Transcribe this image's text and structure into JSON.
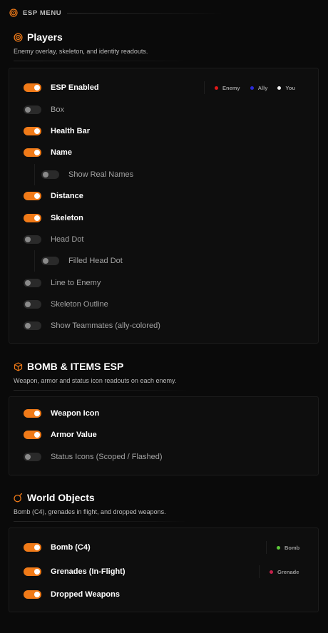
{
  "menu": {
    "title": "ESP MENU",
    "icon": "target-icon"
  },
  "players": {
    "title": "Players",
    "description": "Enemy overlay, skeleton, and identity readouts.",
    "icon": "target-icon",
    "legend": [
      {
        "label": "Enemy",
        "color": "#e01818"
      },
      {
        "label": "Ally",
        "color": "#2a2ad8"
      },
      {
        "label": "You",
        "color": "#f2f2f2"
      }
    ],
    "items": [
      {
        "label": "ESP Enabled",
        "on": true
      },
      {
        "label": "Box",
        "on": false
      },
      {
        "label": "Health Bar",
        "on": true
      },
      {
        "label": "Name",
        "on": true
      },
      {
        "label": "Show Real Names",
        "on": false
      },
      {
        "label": "Distance",
        "on": true
      },
      {
        "label": "Skeleton",
        "on": true
      },
      {
        "label": "Head Dot",
        "on": false
      },
      {
        "label": "Filled Head Dot",
        "on": false
      },
      {
        "label": "Line to Enemy",
        "on": false
      },
      {
        "label": "Skeleton Outline",
        "on": false
      },
      {
        "label": "Show Teammates (ally-colored)",
        "on": false
      }
    ]
  },
  "bomb_items": {
    "title": "BOMB & ITEMS ESP",
    "description": "Weapon, armor and status icon readouts on each enemy.",
    "icon": "cube-icon",
    "items": [
      {
        "label": "Weapon Icon",
        "on": true
      },
      {
        "label": "Armor Value",
        "on": true
      },
      {
        "label": "Status Icons (Scoped / Flashed)",
        "on": false
      }
    ]
  },
  "world_objects": {
    "title": "World Objects",
    "description": "Bomb (C4), grenades in flight, and dropped weapons.",
    "icon": "bomb-icon",
    "items": [
      {
        "label": "Bomb (C4)",
        "on": true,
        "legend": {
          "label": "Bomb",
          "color": "#5cc839"
        }
      },
      {
        "label": "Grenades (In-Flight)",
        "on": true,
        "legend": {
          "label": "Grenade",
          "color": "#c4204a"
        }
      },
      {
        "label": "Dropped Weapons",
        "on": true
      }
    ]
  },
  "colors": {
    "accent": "#f07a18",
    "panel": "#0e0e0e",
    "background": "#0a0a0a"
  }
}
